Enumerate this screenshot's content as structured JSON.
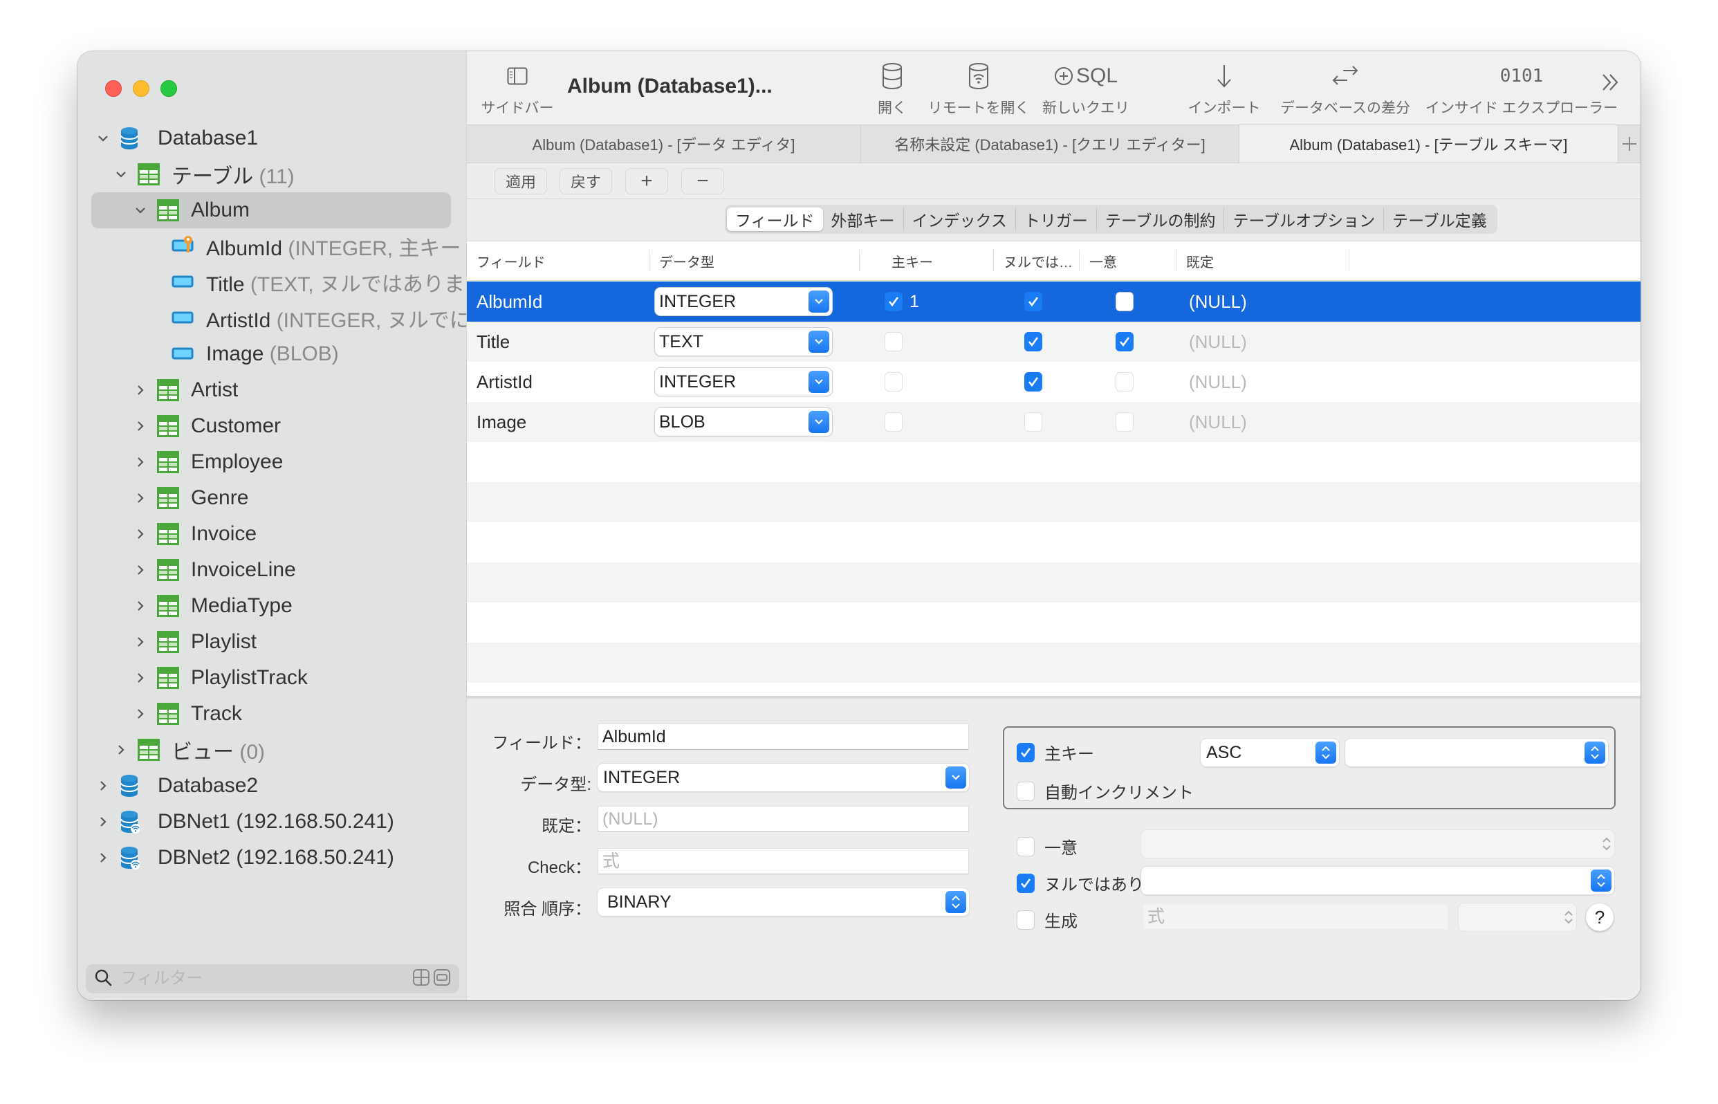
{
  "window": {
    "title": "Album (Database1)..."
  },
  "sidebar": {
    "tree": [
      {
        "label": "Database1",
        "suffix": "",
        "kind": "database",
        "expanded": true,
        "level": 0
      },
      {
        "label": "テーブル",
        "suffix": " (11)",
        "kind": "table-group",
        "expanded": true,
        "level": 1
      },
      {
        "label": "Album",
        "suffix": "",
        "kind": "table",
        "expanded": true,
        "level": 2,
        "selected": true
      },
      {
        "label": "AlbumId",
        "suffix": " (INTEGER, 主キー",
        "kind": "primary-key-column",
        "level": 3
      },
      {
        "label": "Title",
        "suffix": " (TEXT, ヌルではありま",
        "kind": "column",
        "level": 3
      },
      {
        "label": "ArtistId",
        "suffix": " (INTEGER, ヌルでに",
        "kind": "column",
        "level": 3
      },
      {
        "label": "Image",
        "suffix": " (BLOB)",
        "kind": "column",
        "level": 3
      },
      {
        "label": "Artist",
        "suffix": "",
        "kind": "table",
        "expanded": false,
        "level": 2
      },
      {
        "label": "Customer",
        "suffix": "",
        "kind": "table",
        "expanded": false,
        "level": 2
      },
      {
        "label": "Employee",
        "suffix": "",
        "kind": "table",
        "expanded": false,
        "level": 2
      },
      {
        "label": "Genre",
        "suffix": "",
        "kind": "table",
        "expanded": false,
        "level": 2
      },
      {
        "label": "Invoice",
        "suffix": "",
        "kind": "table",
        "expanded": false,
        "level": 2
      },
      {
        "label": "InvoiceLine",
        "suffix": "",
        "kind": "table",
        "expanded": false,
        "level": 2
      },
      {
        "label": "MediaType",
        "suffix": "",
        "kind": "table",
        "expanded": false,
        "level": 2
      },
      {
        "label": "Playlist",
        "suffix": "",
        "kind": "table",
        "expanded": false,
        "level": 2
      },
      {
        "label": "PlaylistTrack",
        "suffix": "",
        "kind": "table",
        "expanded": false,
        "level": 2
      },
      {
        "label": "Track",
        "suffix": "",
        "kind": "table",
        "expanded": false,
        "level": 2
      },
      {
        "label": "ビュー",
        "suffix": " (0)",
        "kind": "table-group",
        "expanded": false,
        "level": 1
      },
      {
        "label": "Database2",
        "suffix": "",
        "kind": "database",
        "expanded": false,
        "level": 0
      },
      {
        "label": "DBNet1 (192.168.50.241)",
        "suffix": "",
        "kind": "network-database",
        "expanded": false,
        "level": 0
      },
      {
        "label": "DBNet2 (192.168.50.241)",
        "suffix": "",
        "kind": "network-database",
        "expanded": false,
        "level": 0
      }
    ],
    "filter_placeholder": "フィルター"
  },
  "toolbar": {
    "sidebar_label": "サイドバー",
    "open_label": "開く",
    "open_remote_label": "リモートを開く",
    "new_query_label": "新しいクエリ",
    "new_query_icon_text": "SQL",
    "import_label": "インポート",
    "diff_label": "データベースの差分",
    "inside_explorer_label": "インサイド エクスプローラー",
    "inside_explorer_icon_text": "0101",
    "more_label": "»"
  },
  "tabs": [
    {
      "label": "Album (Database1) - [データ エディタ]",
      "active": false
    },
    {
      "label": "名称未設定 (Database1) - [クエリ エディター]",
      "active": false
    },
    {
      "label": "Album (Database1) - [テーブル スキーマ]",
      "active": true
    }
  ],
  "actions": {
    "apply": "適用",
    "revert": "戻す",
    "add": "+",
    "remove": "−"
  },
  "segments": [
    {
      "label": "フィールド",
      "active": true
    },
    {
      "label": "外部キー",
      "active": false
    },
    {
      "label": "インデックス",
      "active": false
    },
    {
      "label": "トリガー",
      "active": false
    },
    {
      "label": "テーブルの制約",
      "active": false
    },
    {
      "label": "テーブルオプション",
      "active": false
    },
    {
      "label": "テーブル定義",
      "active": false
    }
  ],
  "grid": {
    "columns": [
      "フィールド",
      "データ型",
      "主キー",
      "ヌルでは…",
      "一意",
      "既定"
    ],
    "rows": [
      {
        "field": "AlbumId",
        "type": "INTEGER",
        "pk": true,
        "pk_order": "1",
        "not_null": true,
        "unique": false,
        "default": "(NULL)",
        "selected": true
      },
      {
        "field": "Title",
        "type": "TEXT",
        "pk": false,
        "pk_order": "",
        "not_null": true,
        "unique": true,
        "default": "(NULL)",
        "selected": false
      },
      {
        "field": "ArtistId",
        "type": "INTEGER",
        "pk": false,
        "pk_order": "",
        "not_null": true,
        "unique": false,
        "default": "(NULL)",
        "selected": false
      },
      {
        "field": "Image",
        "type": "BLOB",
        "pk": false,
        "pk_order": "",
        "not_null": false,
        "unique": false,
        "default": "(NULL)",
        "selected": false
      }
    ]
  },
  "detail": {
    "field_label": "フィールド：",
    "field_value": "AlbumId",
    "type_label": "データ型:",
    "type_value": "INTEGER",
    "default_label": "既定：",
    "default_placeholder": "(NULL)",
    "check_label": "Check：",
    "check_placeholder": "式",
    "collation_label": "照合 順序：",
    "collation_value": "BINARY",
    "primary_key_label": "主キー",
    "primary_key_checked": true,
    "pk_order_value": "ASC",
    "pk_conflict_value": "",
    "autoincrement_label": "自動インクリメント",
    "autoincrement_checked": false,
    "unique_label": "一意",
    "unique_checked": false,
    "unique_conflict_value": "",
    "not_null_label": "ヌルではあり",
    "not_null_checked": true,
    "not_null_conflict_value": "",
    "generated_label": "生成",
    "generated_checked": false,
    "generated_placeholder": "式",
    "generated_kind_value": "",
    "help_label": "?"
  },
  "colors": {
    "accent": "#1a7cf4",
    "selection": "#1467dd",
    "table_icon": "#4aa83a",
    "db_icon": "#1e86c8",
    "key_icon": "#f29a38"
  }
}
